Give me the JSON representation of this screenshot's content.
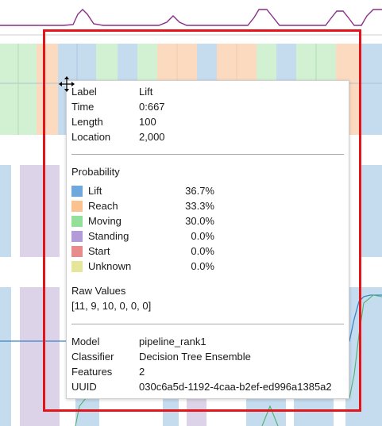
{
  "colors": {
    "lift": "#c5dcef",
    "reach": "#fbdac0",
    "moving": "#d2f0d2",
    "standing": "#ddd3e8",
    "signal_purple": "#8a2f87",
    "signal_blue": "#3b86c8",
    "signal_green": "#4db36f",
    "highlight": "#e2151b"
  },
  "tooltip": {
    "label_label": "Label",
    "label_value": "Lift",
    "time_label": "Time",
    "time_value": "0:667",
    "length_label": "Length",
    "length_value": "100",
    "location_label": "Location",
    "location_value": "2,000",
    "probability_title": "Probability",
    "probabilities": [
      {
        "name": "Lift",
        "value": "36.7%",
        "color": "#6fa8dc"
      },
      {
        "name": "Reach",
        "value": "33.3%",
        "color": "#f9c28e"
      },
      {
        "name": "Moving",
        "value": "30.0%",
        "color": "#93e09a"
      },
      {
        "name": "Standing",
        "value": "0.0%",
        "color": "#b19cd9"
      },
      {
        "name": "Start",
        "value": "0.0%",
        "color": "#e68c8c"
      },
      {
        "name": "Unknown",
        "value": "0.0%",
        "color": "#e6e69a"
      }
    ],
    "raw_values_title": "Raw Values",
    "raw_values": "[11, 9, 10, 0, 0, 0]",
    "model_label": "Model",
    "model_value": "pipeline_rank1",
    "classifier_label": "Classifier",
    "classifier_value": "Decision Tree Ensemble",
    "features_label": "Features",
    "features_value": "2",
    "uuid_label": "UUID",
    "uuid_value": "030c6a5d-1192-4caa-b2ef-ed996a1385a2"
  }
}
